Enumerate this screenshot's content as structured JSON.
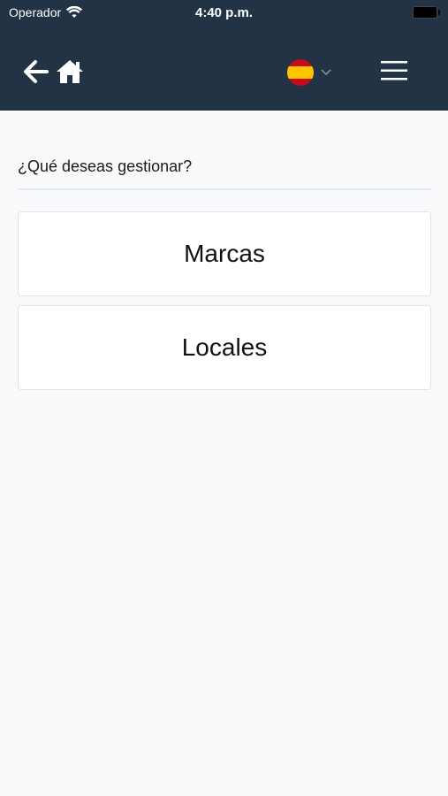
{
  "status_bar": {
    "carrier": "Operador",
    "time": "4:40 p.m."
  },
  "header": {
    "icons": {
      "back": "arrow-left-icon",
      "home": "home-icon",
      "language": "flag-spain-icon",
      "language_dropdown": "chevron-down-icon",
      "menu": "hamburger-menu-icon"
    },
    "colors": {
      "background": "#213344",
      "foreground": "#ffffff"
    }
  },
  "main": {
    "question": "¿Qué deseas gestionar?",
    "options": [
      {
        "label": "Marcas"
      },
      {
        "label": "Locales"
      }
    ]
  }
}
